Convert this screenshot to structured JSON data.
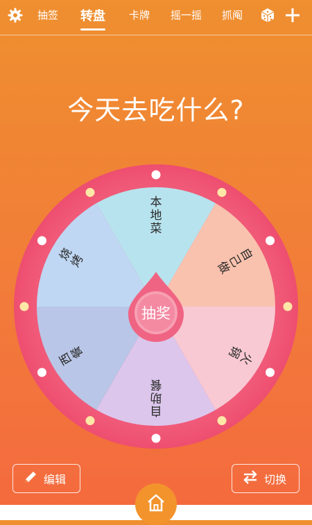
{
  "nav": {
    "tabs": [
      {
        "label": "抽签"
      },
      {
        "label": "转盘"
      },
      {
        "label": "卡牌"
      },
      {
        "label": "摇一摇"
      },
      {
        "label": "抓阄"
      }
    ],
    "active_tab": "转盘",
    "icons": {
      "settings": "gear-icon",
      "dice": "dice-icon",
      "add": "plus-icon"
    }
  },
  "title": "今天去吃什么?",
  "wheel": {
    "center_label": "抽奖",
    "segments": [
      {
        "label": "本地菜",
        "color": "#b7e3ee"
      },
      {
        "label": "自己做",
        "color": "#f9c2ae"
      },
      {
        "label": "火锅",
        "color": "#f8c9d3"
      },
      {
        "label": "自助餐",
        "color": "#dcc6ec"
      },
      {
        "label": "西餐",
        "color": "#b9c6e7"
      },
      {
        "label": "烧烤",
        "color": "#bfd7f3"
      }
    ],
    "rim_color": "#f05a78",
    "pointer_color": "#f06483"
  },
  "bottom": {
    "edit_label": "编辑",
    "switch_label": "切换",
    "icons": {
      "edit": "pencil-icon",
      "switch": "swap-icon",
      "home": "home-icon"
    }
  },
  "colors": {
    "background": "#ef8f2f",
    "accent": "#f2932c"
  }
}
